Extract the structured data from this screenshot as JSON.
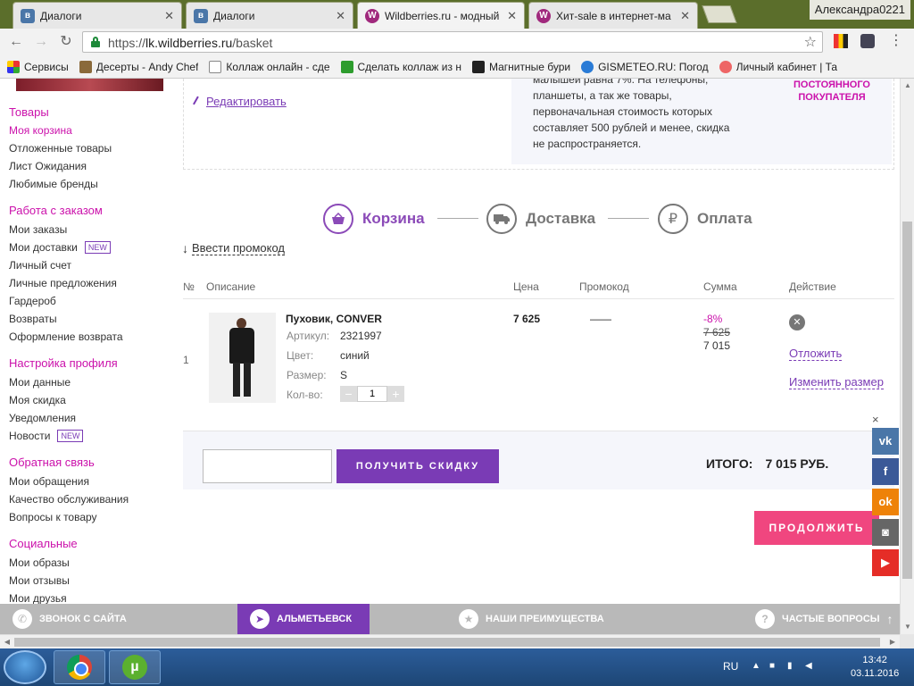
{
  "browser": {
    "tabs": [
      {
        "title": "Диалоги",
        "favicon": "vk-icon",
        "active": false
      },
      {
        "title": "Диалоги",
        "favicon": "vk-icon",
        "active": false
      },
      {
        "title": "Wildberries.ru - модный",
        "favicon": "wildberries-icon",
        "active": true
      },
      {
        "title": "Хит-sale в интернет-ма",
        "favicon": "wildberries-icon",
        "active": false
      }
    ],
    "user": "Александра0221",
    "url_scheme": "https://",
    "url_host": "lk.wildberries.ru",
    "url_path": "/basket",
    "bookmarks": [
      "Сервисы",
      "Десерты - Andy Chef",
      "Коллаж онлайн - сде",
      "Сделать коллаж из н",
      "Магнитные бури",
      "GISMETEO.RU: Погод",
      "Личный кабинет | Та"
    ]
  },
  "sidebar": {
    "sections": [
      {
        "title": "Товары",
        "items": [
          {
            "label": "Моя корзина",
            "current": true
          },
          {
            "label": "Отложенные товары"
          },
          {
            "label": "Лист Ожидания"
          },
          {
            "label": "Любимые бренды"
          }
        ]
      },
      {
        "title": "Работа с заказом",
        "items": [
          {
            "label": "Мои заказы"
          },
          {
            "label": "Мои доставки",
            "badge": "NEW"
          },
          {
            "label": "Личный счет"
          },
          {
            "label": "Личные предложения"
          },
          {
            "label": "Гардероб"
          },
          {
            "label": "Возвраты"
          },
          {
            "label": "Оформление возврата"
          }
        ]
      },
      {
        "title": "Настройка профиля",
        "items": [
          {
            "label": "Мои данные"
          },
          {
            "label": "Моя скидка"
          },
          {
            "label": "Уведомления"
          },
          {
            "label": "Новости",
            "badge": "NEW"
          }
        ]
      },
      {
        "title": "Обратная связь",
        "items": [
          {
            "label": "Мои обращения"
          },
          {
            "label": "Качество обслуживания"
          },
          {
            "label": "Вопросы к товару"
          }
        ]
      },
      {
        "title": "Социальные",
        "items": [
          {
            "label": "Мои образы"
          },
          {
            "label": "Мои отзывы"
          },
          {
            "label": "Мои друзья"
          }
        ]
      }
    ]
  },
  "info": {
    "edit_label": "Редактировать",
    "text_lines": [
      "малышей равна 7%. На телефоны,",
      "планшеты, а так же товары,",
      "первоначальная стоимость которых",
      "составляет 500 рублей и менее, скидка",
      "не распространяется."
    ],
    "note_lines": [
      "ПОСТОЯННОГО",
      "ПОКУПАТЕЛЯ"
    ]
  },
  "steps": [
    {
      "label": "Корзина",
      "icon": "basket-icon",
      "active": true
    },
    {
      "label": "Доставка",
      "icon": "truck-icon",
      "active": false
    },
    {
      "label": "Оплата",
      "icon": "ruble-icon",
      "active": false
    }
  ],
  "promo_link": "Ввести промокод",
  "table": {
    "headers": {
      "num": "№",
      "desc": "Описание",
      "price": "Цена",
      "promo": "Промокод",
      "sum": "Сумма",
      "action": "Действие"
    },
    "rows": [
      {
        "num": "1",
        "name": "Пуховик, CONVER",
        "article_label": "Артикул:",
        "article": "2321997",
        "color_label": "Цвет:",
        "color": "синий",
        "size_label": "Размер:",
        "size": "S",
        "qty_label": "Кол-во:",
        "qty": "1",
        "qty_minus": "−",
        "qty_plus": "+",
        "price": "7 625",
        "promo": "——",
        "discount": "-8%",
        "old_sum": "7 625",
        "sum": "7 015",
        "postpone": "Отложить",
        "change_size": "Изменить размер"
      }
    ]
  },
  "discount": {
    "input_value": "",
    "button_label": "ПОЛУЧИТЬ СКИДКУ",
    "total_label": "ИТОГО:",
    "total_value": "7 015 РУБ."
  },
  "continue_label": "ПРОДОЛЖИТЬ",
  "social": {
    "close": "×",
    "items": [
      {
        "name": "vk",
        "glyph": "vk",
        "color": "#4a76a8"
      },
      {
        "name": "facebook",
        "glyph": "f",
        "color": "#3b5998"
      },
      {
        "name": "odnoklassniki",
        "glyph": "ok",
        "color": "#ee8208"
      },
      {
        "name": "instagram",
        "glyph": "◙",
        "color": "#666666"
      },
      {
        "name": "youtube",
        "glyph": "▶",
        "color": "#e52d27"
      }
    ]
  },
  "bottom_bar": {
    "call": "ЗВОНОК С САЙТА",
    "city": "АЛЬМЕТЬЕВСК",
    "advantages": "НАШИ ПРЕИМУЩЕСТВА",
    "faq": "ЧАСТЫЕ ВОПРОСЫ"
  },
  "taskbar": {
    "lang": "RU",
    "time": "13:42",
    "date": "03.11.2016"
  },
  "colors": {
    "brand_purple": "#7a3bb5",
    "brand_pink": "#cb11ab",
    "continue_pink": "#f0467f"
  }
}
